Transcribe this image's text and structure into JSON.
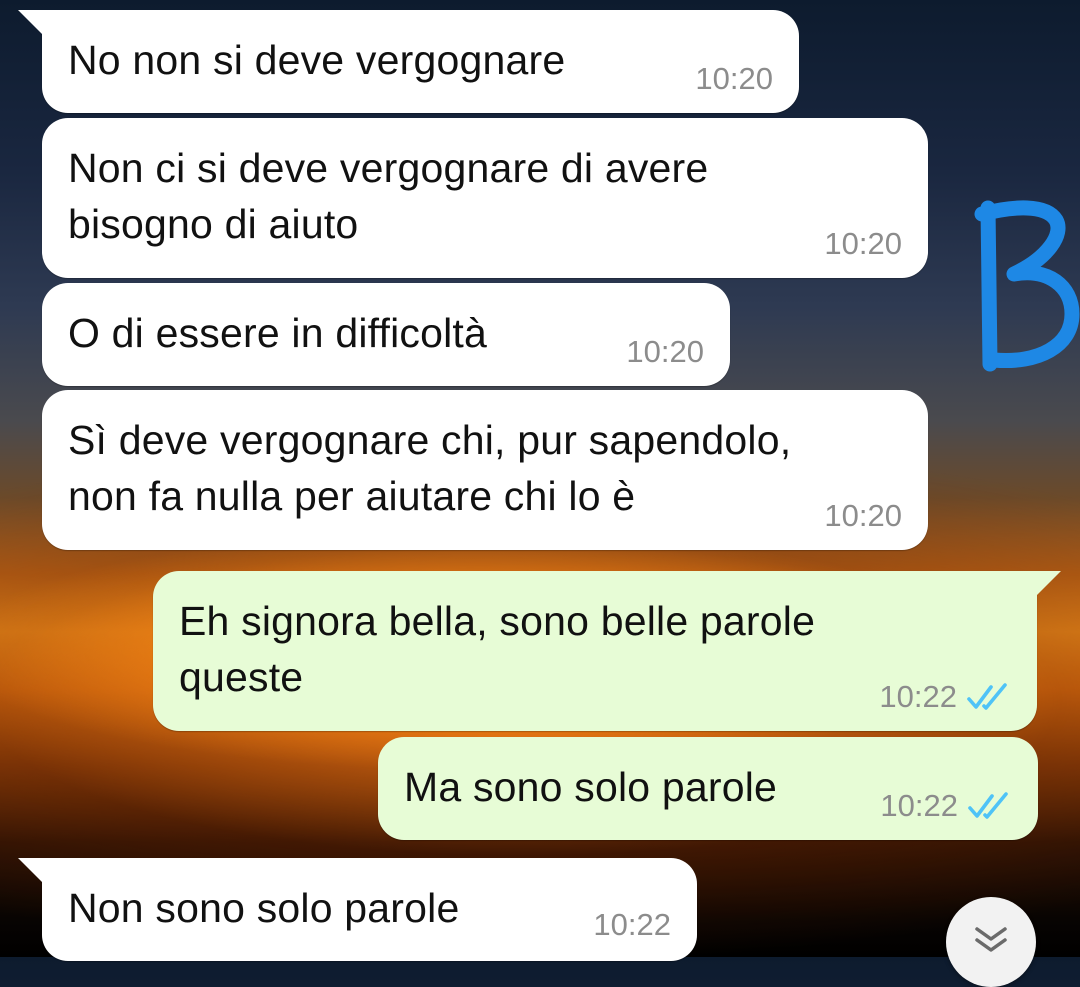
{
  "messages": [
    {
      "direction": "in",
      "text": "No non si deve vergognare",
      "time": "10:20"
    },
    {
      "direction": "in",
      "text": "Non ci si deve vergognare di avere\nbisogno di aiuto",
      "time": "10:20"
    },
    {
      "direction": "in",
      "text": "O di essere in difficoltà",
      "time": "10:20"
    },
    {
      "direction": "in",
      "text": "Sì deve vergognare chi, pur sapendolo,\nnon fa nulla per aiutare chi lo è",
      "time": "10:20"
    },
    {
      "direction": "out",
      "text": "Eh signora bella, sono belle parole\nqueste",
      "time": "10:22",
      "status": "read"
    },
    {
      "direction": "out",
      "text": "Ma sono solo parole",
      "time": "10:22",
      "status": "read"
    },
    {
      "direction": "in",
      "text": "Non sono solo parole",
      "time": "10:22"
    }
  ],
  "overlay": {
    "handwritten_letter": "B",
    "letter_color": "#1e88e5"
  },
  "colors": {
    "incoming_bubble": "#ffffff",
    "outgoing_bubble": "#e7fcd6",
    "read_ticks": "#4fc3f7",
    "timestamp": "#8c8c8c"
  },
  "icons": {
    "read_receipt": "double-check-icon",
    "scroll_down": "chevron-double-down-icon"
  }
}
